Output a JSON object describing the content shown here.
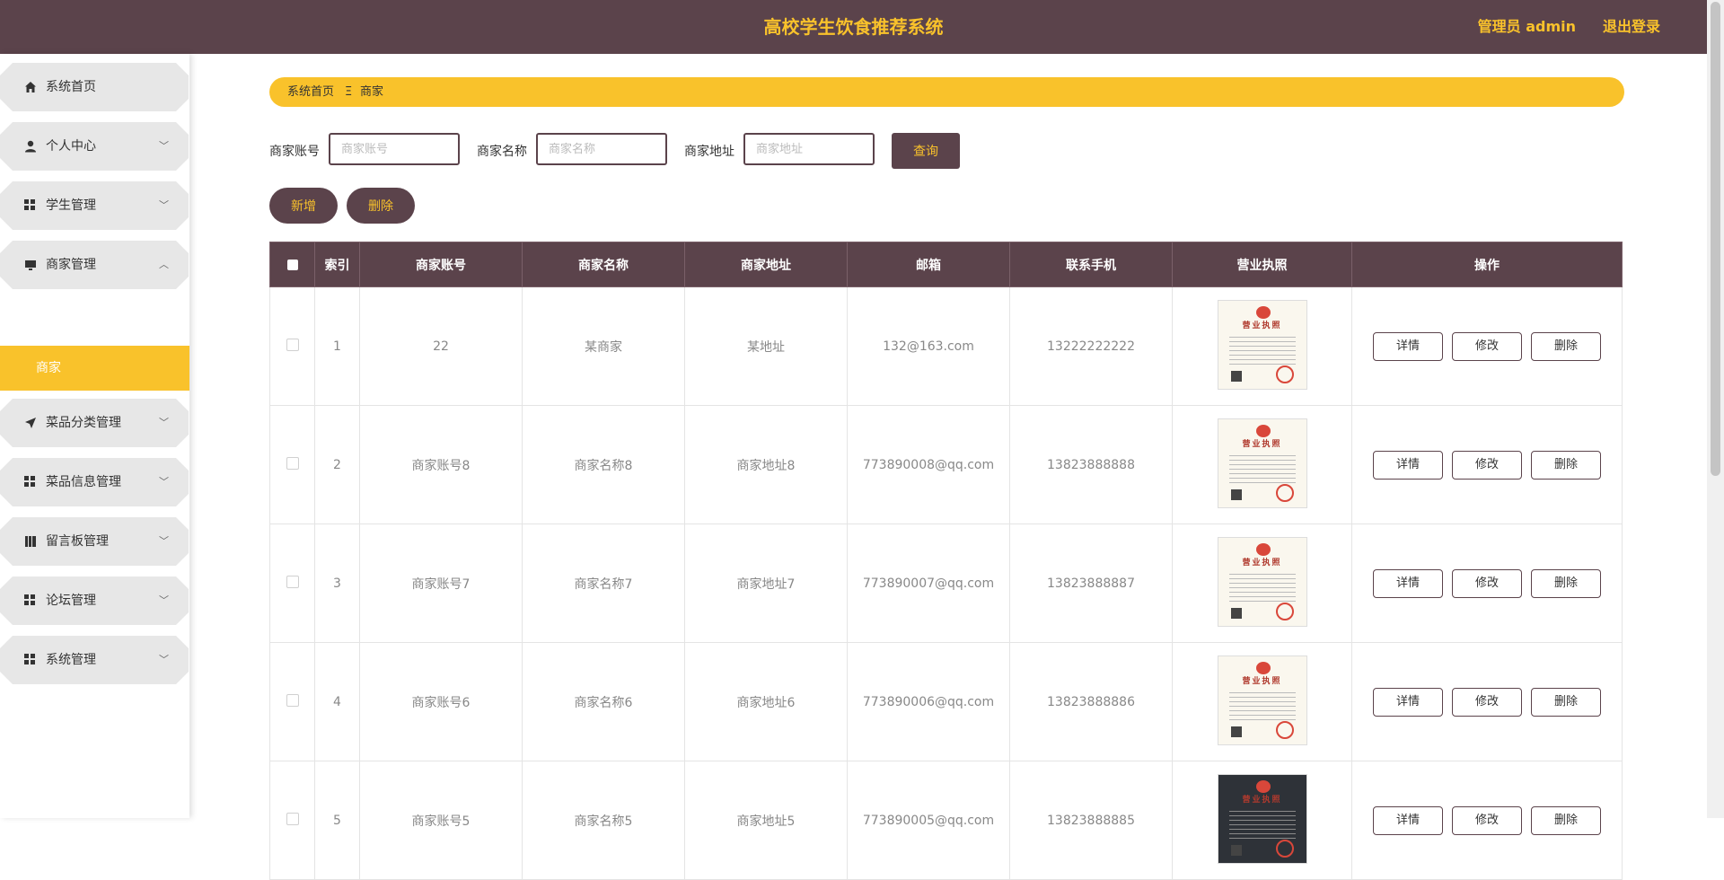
{
  "header": {
    "title": "高校学生饮食推荐系统",
    "admin_label": "管理员 admin",
    "logout_label": "退出登录"
  },
  "sidebar": {
    "items": [
      {
        "label": "系统首页",
        "icon": "home-icon"
      },
      {
        "label": "个人中心",
        "icon": "user-icon"
      },
      {
        "label": "学生管理",
        "icon": "grid-icon"
      },
      {
        "label": "商家管理",
        "icon": "monitor-icon",
        "expanded": true
      },
      {
        "label": "菜品分类管理",
        "icon": "send-icon"
      },
      {
        "label": "菜品信息管理",
        "icon": "grid-icon"
      },
      {
        "label": "留言板管理",
        "icon": "book-icon"
      },
      {
        "label": "论坛管理",
        "icon": "grid-icon"
      },
      {
        "label": "系统管理",
        "icon": "grid-icon"
      }
    ],
    "sub_item": "商家"
  },
  "breadcrumb": {
    "home": "系统首页",
    "separator": "Ξ",
    "current": "商家"
  },
  "filters": {
    "account_label": "商家账号",
    "account_placeholder": "商家账号",
    "name_label": "商家名称",
    "name_placeholder": "商家名称",
    "address_label": "商家地址",
    "address_placeholder": "商家地址",
    "search_button": "查询"
  },
  "toolbar": {
    "add_label": "新增",
    "delete_label": "删除"
  },
  "table": {
    "columns": [
      "索引",
      "商家账号",
      "商家名称",
      "商家地址",
      "邮箱",
      "联系手机",
      "营业执照",
      "操作"
    ],
    "license_text": "营业执照",
    "actions": {
      "detail": "详情",
      "edit": "修改",
      "delete": "删除"
    },
    "rows": [
      {
        "index": "1",
        "account": "22",
        "name": "某商家",
        "address": "某地址",
        "email": "132@163.com",
        "phone": "13222222222"
      },
      {
        "index": "2",
        "account": "商家账号8",
        "name": "商家名称8",
        "address": "商家地址8",
        "email": "773890008@qq.com",
        "phone": "13823888888"
      },
      {
        "index": "3",
        "account": "商家账号7",
        "name": "商家名称7",
        "address": "商家地址7",
        "email": "773890007@qq.com",
        "phone": "13823888887"
      },
      {
        "index": "4",
        "account": "商家账号6",
        "name": "商家名称6",
        "address": "商家地址6",
        "email": "773890006@qq.com",
        "phone": "13823888886"
      },
      {
        "index": "5",
        "account": "商家账号5",
        "name": "商家名称5",
        "address": "商家地址5",
        "email": "773890005@qq.com",
        "phone": "13823888885"
      }
    ]
  },
  "colors": {
    "primary": "#5b434b",
    "accent": "#f9c22b"
  }
}
